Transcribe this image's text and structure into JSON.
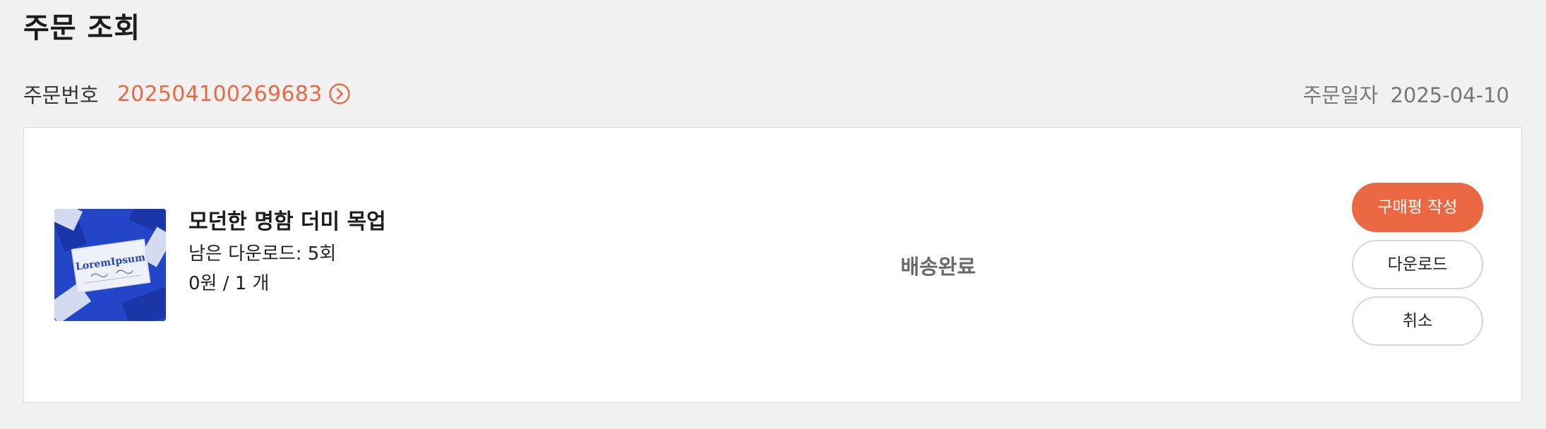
{
  "page": {
    "title": "주문 조회"
  },
  "order": {
    "number_label": "주문번호",
    "number": "202504100269683",
    "date_label": "주문일자",
    "date": "2025-04-10"
  },
  "item": {
    "image_alt": "business card mockup",
    "image_text": "LoremIpsum",
    "name": "모던한 명함 더미 목업",
    "downloads_remaining": "남은 다운로드: 5회",
    "price_qty": "0원 / 1 개",
    "status": "배송완료"
  },
  "actions": {
    "review": "구매평 작성",
    "download": "다운로드",
    "cancel": "취소"
  },
  "colors": {
    "accent": "#ec6842",
    "background": "#f1f1f1",
    "card": "#ffffff",
    "thumb_blue": "#2346c9"
  }
}
